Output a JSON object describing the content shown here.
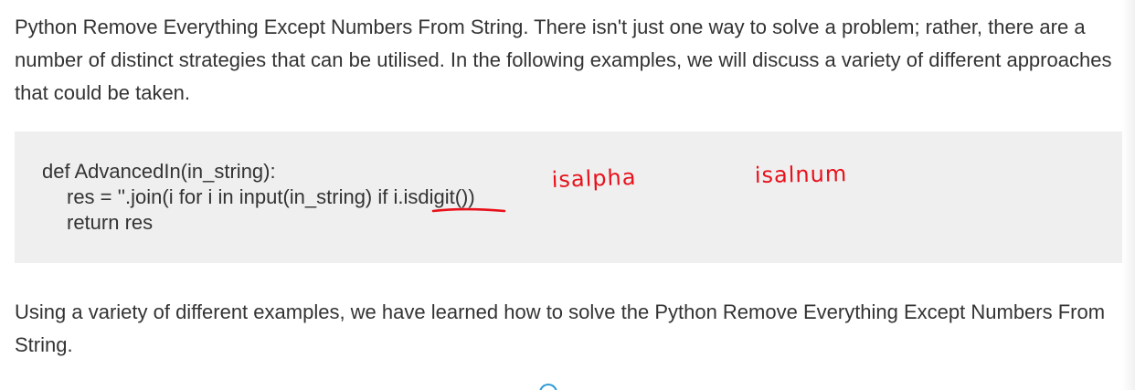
{
  "intro_paragraph": "Python Remove Everything Except Numbers From String. There isn't just one way to solve a problem; rather, there are a number of distinct strategies that can be utilised. In the following examples, we will discuss a variety of different approaches that could be taken.",
  "code": {
    "line1": "def AdvancedIn(in_string):",
    "line2_prefix": "res = ''.join(i for i in input(in_string) if ",
    "line2_underlined": "i.isdigit()",
    "line2_suffix": ")",
    "line3": "return res"
  },
  "handwriting": {
    "note1": "isalpha",
    "note2": "isalnum",
    "ink_color": "#e8101a"
  },
  "outro_paragraph": "Using a variety of different examples, we have learned how to solve the Python Remove Everything Except Numbers From String."
}
